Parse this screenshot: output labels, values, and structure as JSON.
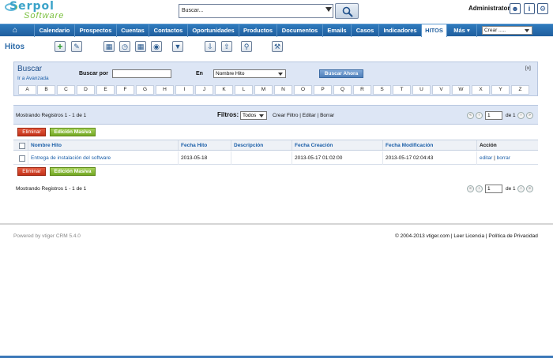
{
  "header": {
    "logo_top": "Serpol",
    "logo_bottom": "Software",
    "search_value": "Buscar...",
    "user": "Administrator"
  },
  "nav": {
    "items": [
      "Calendario",
      "Prospectos",
      "Cuentas",
      "Contactos",
      "Oportunidades",
      "Productos",
      "Documentos",
      "Emails",
      "Casos",
      "Indicadores",
      "HITOS",
      "Más"
    ],
    "create_select": "Crear ....."
  },
  "module": {
    "title": "Hitos"
  },
  "search": {
    "title": "Buscar",
    "advanced_link": "Ir a Avanzada",
    "buscar_por_label": "Buscar por",
    "en_label": "En",
    "field_select": "Nombre Hito",
    "submit": "Buscar Ahora",
    "close": "[x]",
    "alphabet": [
      "A",
      "B",
      "C",
      "D",
      "E",
      "F",
      "G",
      "H",
      "I",
      "J",
      "K",
      "L",
      "M",
      "N",
      "O",
      "P",
      "Q",
      "R",
      "S",
      "T",
      "U",
      "V",
      "W",
      "X",
      "Y",
      "Z"
    ]
  },
  "listing": {
    "records_top": "Mostrando Registros 1 - 1 de 1",
    "records_bottom": "Mostrando Registros 1 - 1 de 1",
    "filter_label": "Filtros:",
    "filter_value": "Todos",
    "filter_links": "Crear Filtro | Editar | Borrar",
    "page_value": "1",
    "page_of": "de 1",
    "delete_button": "Eliminar",
    "mass_edit_button": "Edición Masiva",
    "columns": [
      "Nombre Hito",
      "Fecha Hito",
      "Descripción",
      "Fecha Creación",
      "Fecha Modificación",
      "Acción"
    ],
    "rows": [
      {
        "name": "Entrega de instalación del software",
        "date": "2013-05-18",
        "description": "",
        "created": "2013-05-17 01:02:00",
        "modified": "2013-05-17 02:04:43",
        "action_edit": "editar",
        "action_sep": "|",
        "action_delete": "borrar"
      }
    ]
  },
  "footer": {
    "powered": "Powered by vtiger CRM 5.4.0",
    "copyright": "© 2004-2013 vtiger.com | Leer Licencia | Política de Privacidad"
  }
}
